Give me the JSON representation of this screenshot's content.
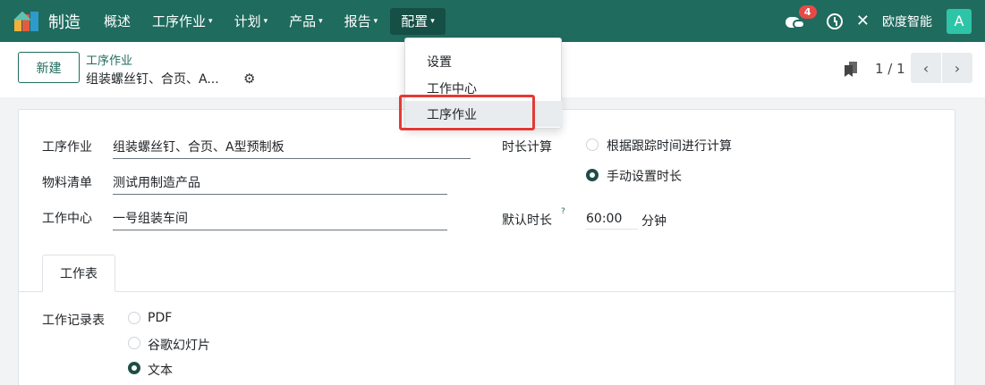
{
  "app": {
    "name": "制造"
  },
  "nav": {
    "items": [
      {
        "label": "概述",
        "caret": ""
      },
      {
        "label": "工序作业",
        "caret": "▾"
      },
      {
        "label": "计划",
        "caret": "▾"
      },
      {
        "label": "产品",
        "caret": "▾"
      },
      {
        "label": "报告",
        "caret": "▾"
      },
      {
        "label": "配置",
        "caret": "▾"
      }
    ],
    "message_count": "4",
    "company": "欧度智能",
    "avatar_letter": "A"
  },
  "dropdown": {
    "items": [
      "设置",
      "工作中心",
      "工序作业"
    ]
  },
  "control": {
    "new_label": "新建",
    "breadcrumb_parent": "工序作业",
    "breadcrumb_current": "组装螺丝钉、合页、A...",
    "pager": "1 / 1"
  },
  "form": {
    "operation_label": "工序作业",
    "operation_value": "组装螺丝钉、合页、A型预制板",
    "bom_label": "物料清单",
    "bom_value": "测试用制造产品",
    "workcenter_label": "工作中心",
    "workcenter_value": "一号组装车间",
    "duration_calc_label": "时长计算",
    "duration_options": [
      "根据跟踪时间进行计算",
      "手动设置时长"
    ],
    "duration_selected": 1,
    "default_duration_label": "默认时长",
    "help_mark": "?",
    "default_duration_value": "60:00",
    "default_duration_unit": "分钟"
  },
  "tabs": [
    {
      "label": "工作表"
    }
  ],
  "worksheet": {
    "label": "工作记录表",
    "options": [
      "PDF",
      "谷歌幻灯片",
      "文本"
    ],
    "selected": 2
  },
  "colors": {
    "navbar": "#1f6b5e",
    "accent": "#1f6b5e",
    "highlight": "#e53935",
    "badge": "#e64a47"
  }
}
